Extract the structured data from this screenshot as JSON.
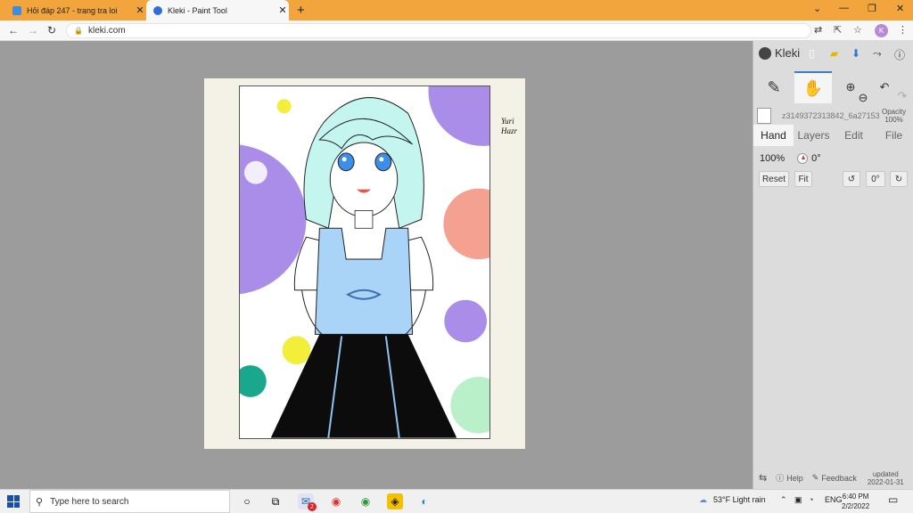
{
  "browser": {
    "tabs": [
      {
        "title": "Hỏi đáp 247 - trang tra loi",
        "active": false
      },
      {
        "title": "Kleki - Paint Tool",
        "active": true
      }
    ],
    "new_tab": "+",
    "url": "kleki.com",
    "profile_initial": "K"
  },
  "artwork": {
    "signature_line1": "Yuri",
    "signature_line2": "Hazr"
  },
  "panel": {
    "brand": "Kleki",
    "layer": {
      "name": "z3149372313842_6a27153",
      "opacity_label": "Opacity",
      "opacity_value": "100%"
    },
    "tabs": [
      "Hand",
      "Layers",
      "Edit",
      "File"
    ],
    "active_tab": "Hand",
    "hand": {
      "zoom": "100%",
      "angle": "0°",
      "reset_label": "Reset",
      "fit_label": "Fit",
      "rotate_value": "0°"
    },
    "footer": {
      "help_label": "Help",
      "feedback_label": "Feedback",
      "updated_label": "updated",
      "updated_date": "2022-01-31"
    }
  },
  "taskbar": {
    "search_placeholder": "Type here to search",
    "chrome_badge": "2",
    "weather": "53°F  Light rain",
    "language": "ENG",
    "time": "6:40 PM",
    "date": "2/2/2022"
  },
  "colors": {
    "tab_bar": "#f2a53c",
    "accent": "#3b7bd6",
    "panel_bg": "#dcdcdc",
    "canvas_bg": "#9c9c9c"
  }
}
